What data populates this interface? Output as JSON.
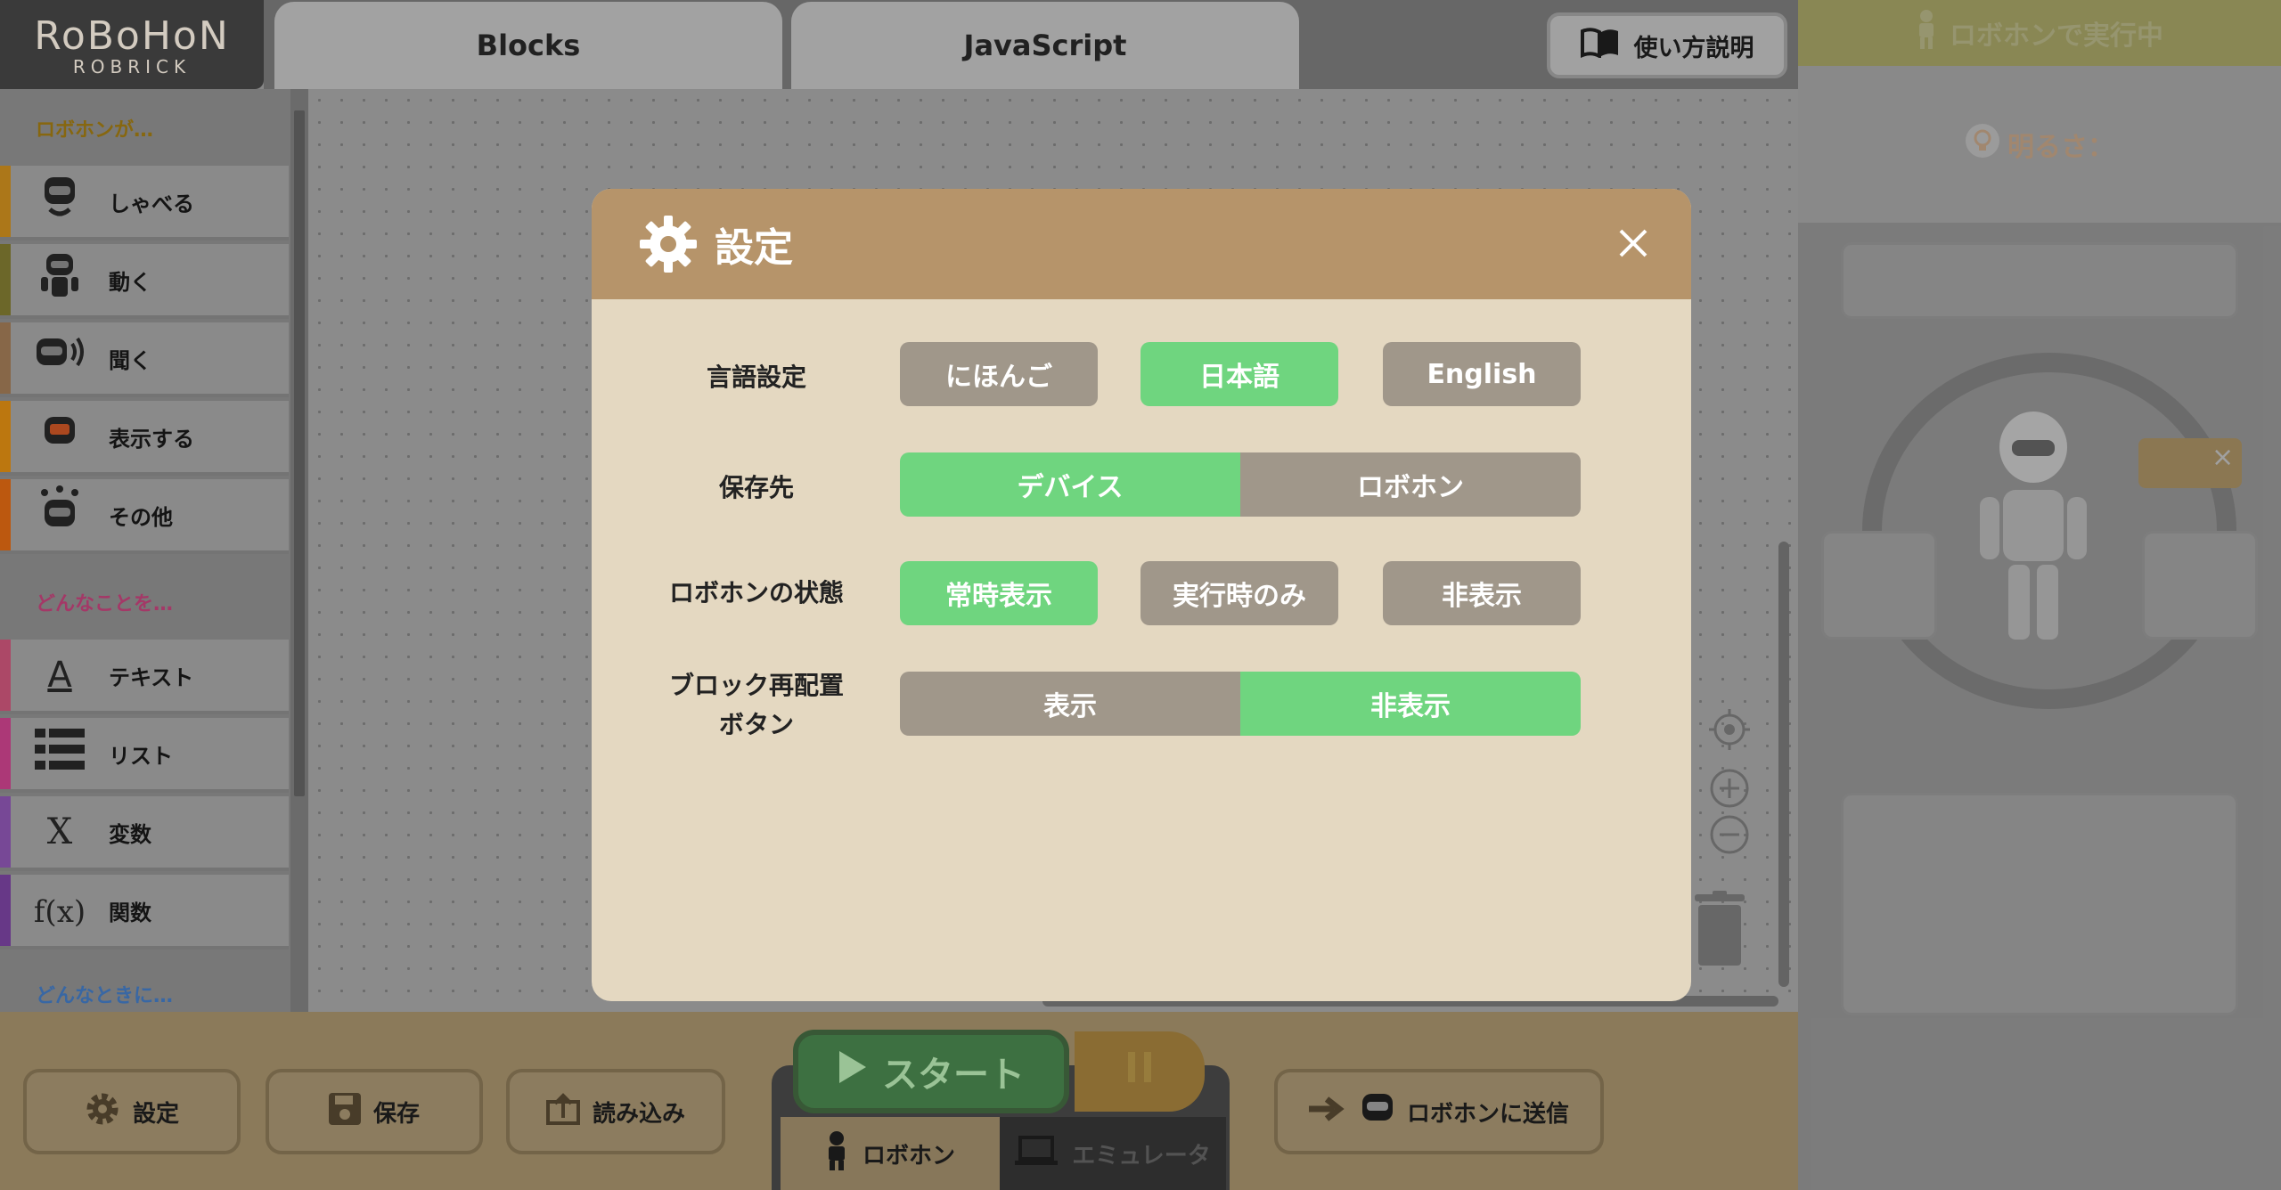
{
  "header": {
    "logo_line1": "RoBoHoN",
    "logo_line2": "ROBRICK",
    "tabs": [
      {
        "label": "Blocks"
      },
      {
        "label": "JavaScript"
      }
    ],
    "help_label": "使い方説明"
  },
  "sidebar": {
    "section1": "ロボホンが…",
    "section2": "どんなことを…",
    "section3": "どんなときに…",
    "items": [
      {
        "label": "しゃべる",
        "color": "#b07a1a"
      },
      {
        "label": "動く",
        "color": "#6f6a2a"
      },
      {
        "label": "聞く",
        "color": "#8a6a4a"
      },
      {
        "label": "表示する",
        "color": "#c07a10"
      },
      {
        "label": "その他",
        "color": "#c05a10"
      },
      {
        "label": "テキスト",
        "color": "#b04a6a"
      },
      {
        "label": "リスト",
        "color": "#b03a7a"
      },
      {
        "label": "変数",
        "color": "#7a4a9a"
      },
      {
        "label": "関数",
        "color": "#6a3a8a"
      }
    ],
    "item_icons": [
      "A",
      "≡",
      "X",
      "f(x)"
    ]
  },
  "right_panel": {
    "running_label": "ロボホンで実行中",
    "brightness_label": "明るさ："
  },
  "bottom": {
    "settings_label": "設定",
    "save_label": "保存",
    "load_label": "読み込み",
    "start_label": "スタート",
    "mode_robohon": "ロボホン",
    "mode_emulator": "エミュレータ",
    "send_label": "ロボホンに送信"
  },
  "modal": {
    "title": "設定",
    "rows": [
      {
        "label": "言語設定",
        "options": [
          "にほんご",
          "日本語",
          "English"
        ],
        "selected": 1
      },
      {
        "label": "保存先",
        "options": [
          "デバイス",
          "ロボホン"
        ],
        "selected": 0
      },
      {
        "label": "ロボホンの状態",
        "options": [
          "常時表示",
          "実行時のみ",
          "非表示"
        ],
        "selected": 0
      },
      {
        "label_line1": "ブロック再配置",
        "label_line2": "ボタン",
        "options": [
          "表示",
          "非表示"
        ],
        "selected": 1
      }
    ]
  },
  "colors": {
    "accent_green": "#6fd57f",
    "modal_header": "#b6946a",
    "modal_body": "#e4d8c1",
    "option_off": "#a0978a"
  }
}
